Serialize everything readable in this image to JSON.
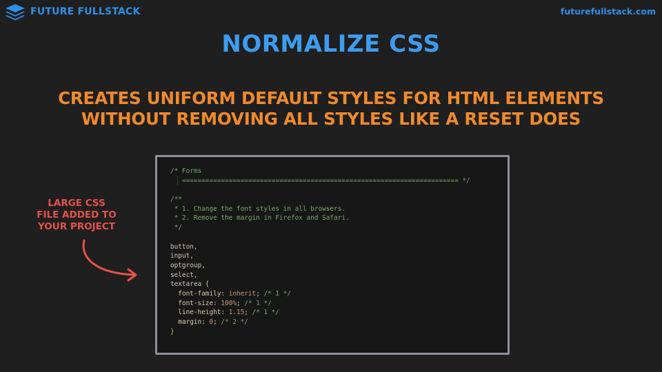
{
  "header": {
    "brand_name": "FUTURE FULLSTACK",
    "logo_icon": "stack-layers-icon",
    "site_url": "futurefullstack.com",
    "accent_color": "#2f8fe6"
  },
  "slide": {
    "title": "NORMALIZE CSS",
    "subtitle_lines": [
      "CREATES UNIFORM DEFAULT STYLES FOR HTML ELEMENTS",
      "WITHOUT REMOVING ALL STYLES LIKE A RESET DOES"
    ],
    "title_color": "#3d9cf0",
    "subtitle_color": "#f08a2c"
  },
  "annotation": {
    "lines": [
      "LARGE CSS",
      "FILE ADDED TO",
      "YOUR PROJECT"
    ],
    "arrow_icon": "curved-arrow-icon",
    "color": "#e8514a"
  },
  "code": {
    "forms_comment": "/* Forms",
    "divider": "======================================================================= */",
    "doc_open": "/**",
    "doc_line1": " * 1. Change the font styles in all browsers.",
    "doc_line2": " * 2. Remove the margin in Firefox and Safari.",
    "doc_close": " */",
    "selectors": [
      "button,",
      "input,",
      "optgroup,",
      "select,",
      "textarea {"
    ],
    "declarations": [
      {
        "prop": "font-family",
        "value": "inherit",
        "note": "/* 1 */"
      },
      {
        "prop": "font-size",
        "value": "100%",
        "note": "/* 1 */"
      },
      {
        "prop": "line-height",
        "value": "1.15",
        "note": "/* 1 */"
      },
      {
        "prop": "margin",
        "value": "0",
        "note": "/* 2 */"
      }
    ],
    "close_brace": "}"
  }
}
